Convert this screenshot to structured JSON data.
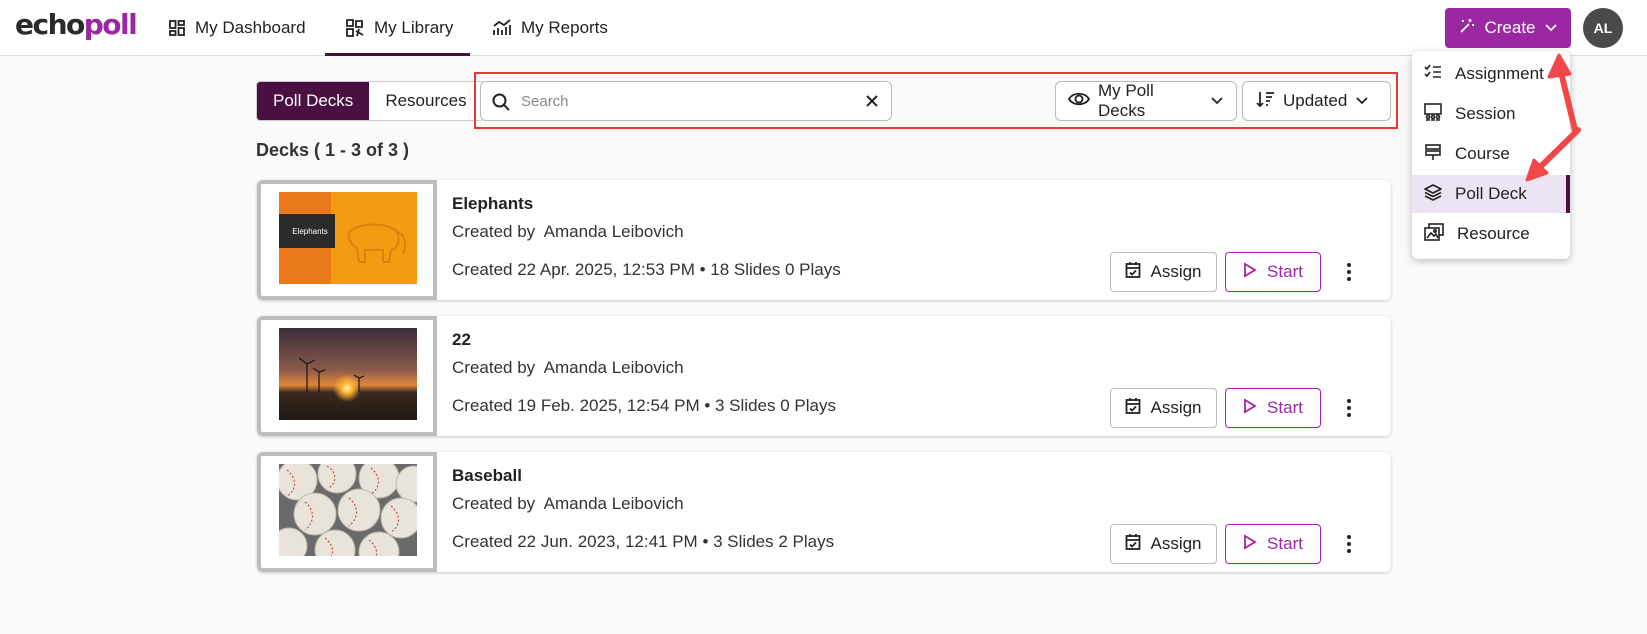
{
  "header": {
    "logo": {
      "part1": "echo",
      "part2": "poll"
    },
    "nav": [
      {
        "label": "My Dashboard",
        "icon": "dashboard-icon"
      },
      {
        "label": "My Library",
        "icon": "library-icon",
        "active": true
      },
      {
        "label": "My Reports",
        "icon": "reports-icon"
      }
    ],
    "create_label": "Create",
    "avatar_initials": "AL"
  },
  "tabs": [
    {
      "label": "Poll Decks",
      "active": true
    },
    {
      "label": "Resources",
      "active": false
    }
  ],
  "search": {
    "placeholder": "Search",
    "value": ""
  },
  "filters": {
    "visibility_label": "My Poll Decks",
    "sort_label": "Updated"
  },
  "deck_count": "Decks ( 1 - 3 of 3 )",
  "decks": [
    {
      "title": "Elephants",
      "author": "Created by  Amanda Leibovich",
      "meta": "Created 22 Apr. 2025, 12:53 PM • 18 Slides 0 Plays",
      "thumb_text": "Elephants"
    },
    {
      "title": "22",
      "author": "Created by  Amanda Leibovich",
      "meta": "Created 19 Feb. 2025, 12:54 PM • 3 Slides 0 Plays"
    },
    {
      "title": "Baseball",
      "author": "Created by  Amanda Leibovich",
      "meta": "Created 22 Jun. 2023, 12:41 PM • 3 Slides 2 Plays"
    }
  ],
  "card_actions": {
    "assign_label": "Assign",
    "start_label": "Start"
  },
  "create_menu": [
    {
      "label": "Assignment",
      "icon": "checklist-icon"
    },
    {
      "label": "Session",
      "icon": "session-icon"
    },
    {
      "label": "Course",
      "icon": "course-icon"
    },
    {
      "label": "Poll Deck",
      "icon": "layers-icon",
      "active": true
    },
    {
      "label": "Resource",
      "icon": "resource-icon"
    }
  ],
  "colors": {
    "brand": "#9b27a3",
    "dark": "#4a1042",
    "annotation": "#e53935"
  }
}
